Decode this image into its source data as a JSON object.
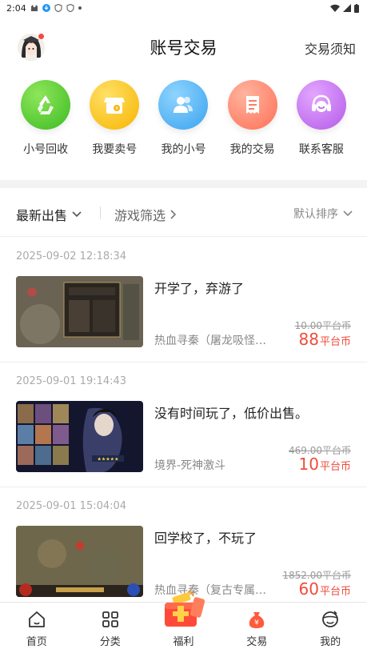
{
  "status_bar": {
    "time": "2:04"
  },
  "header": {
    "title": "账号交易",
    "notice_link": "交易须知"
  },
  "quick_actions": [
    {
      "label": "小号回收",
      "icon": "recycle-icon",
      "color": "#5ccd3a"
    },
    {
      "label": "我要卖号",
      "icon": "shop-icon",
      "color": "#ffc61a"
    },
    {
      "label": "我的小号",
      "icon": "users-icon",
      "color": "#4fb6f5"
    },
    {
      "label": "我的交易",
      "icon": "receipt-icon",
      "color": "#ff8a72"
    },
    {
      "label": "联系客服",
      "icon": "headset-icon",
      "color": "#c773f0"
    }
  ],
  "filters": {
    "latest": "最新出售",
    "game_filter": "游戏筛选",
    "sort": "默认排序"
  },
  "listings": [
    {
      "date": "2025-09-02 12:18:34",
      "title": "开学了，弃游了",
      "game": "热血寻秦（屠龙吸怪…",
      "original_price": "10.00平台币",
      "price": "88",
      "unit": "平台币"
    },
    {
      "date": "2025-09-01 19:14:43",
      "title": "没有时间玩了，低价出售。",
      "game": "境界-死神激斗",
      "original_price": "469.00平台币",
      "price": "10",
      "unit": "平台币"
    },
    {
      "date": "2025-09-01 15:04:04",
      "title": "回学校了，不玩了",
      "game": "热血寻秦（复古专属…",
      "original_price": "1852.00平台币",
      "price": "60",
      "unit": "平台币"
    }
  ],
  "nav": [
    {
      "label": "首页",
      "icon": "home-icon"
    },
    {
      "label": "分类",
      "icon": "grid-icon"
    },
    {
      "label": "福利",
      "icon": "gift-icon"
    },
    {
      "label": "交易",
      "icon": "money-bag-icon"
    },
    {
      "label": "我的",
      "icon": "profile-icon"
    }
  ],
  "colors": {
    "accent": "#f04b3c"
  }
}
